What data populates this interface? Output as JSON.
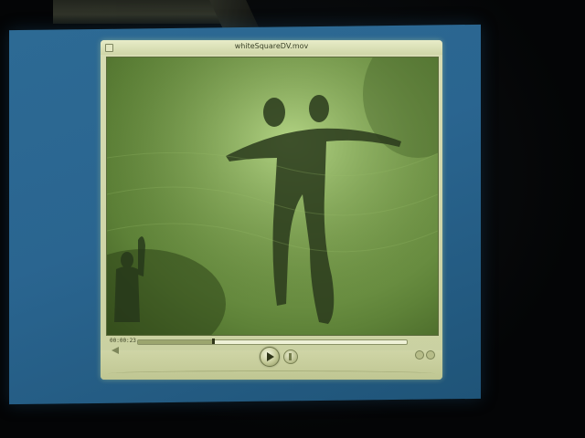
{
  "window": {
    "title": "whiteSquareDV.mov"
  },
  "controls": {
    "timecode": "00:00:23",
    "progress": 0.28,
    "play_icon": "play-icon",
    "step_icon": "step-forward-icon",
    "volume_icon": "speaker-icon"
  },
  "colors": {
    "screen": "#2a6590",
    "player_chrome": "#ccd3a3",
    "video_tint": "#7fa452"
  }
}
